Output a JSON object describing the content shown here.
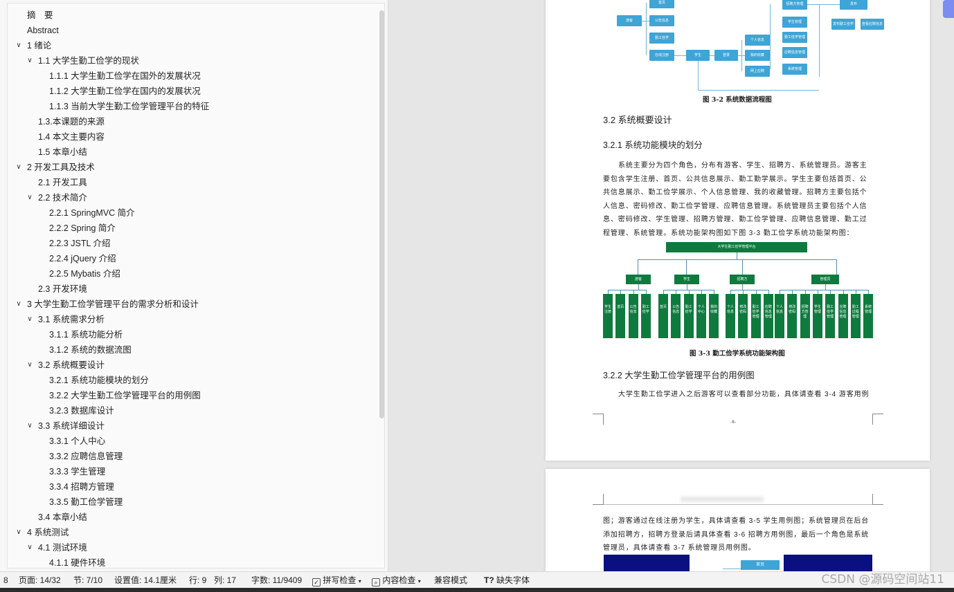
{
  "nav": {
    "items": [
      {
        "label": "摘　要",
        "level": 0,
        "expanded": null
      },
      {
        "label": "Abstract",
        "level": 0,
        "expanded": null
      },
      {
        "label": "1  绪论",
        "level": 0,
        "expanded": true
      },
      {
        "label": "1.1  大学生勤工俭学的现状",
        "level": 1,
        "expanded": true
      },
      {
        "label": "1.1.1  大学生勤工俭学在国外的发展状况",
        "level": 2,
        "expanded": null
      },
      {
        "label": "1.1.2  大学生勤工俭学在国内的发展状况",
        "level": 2,
        "expanded": null
      },
      {
        "label": "1.1.3  当前大学生勤工俭学管理平台的特征",
        "level": 2,
        "expanded": null
      },
      {
        "label": "1.3.本课题的来源",
        "level": 1,
        "expanded": null
      },
      {
        "label": "1.4 本文主要内容",
        "level": 1,
        "expanded": null
      },
      {
        "label": "1.5  本章小结",
        "level": 1,
        "expanded": null
      },
      {
        "label": "2  开发工具及技术",
        "level": 0,
        "expanded": true
      },
      {
        "label": "2.1 开发工具",
        "level": 1,
        "expanded": null
      },
      {
        "label": "2.2 技术简介",
        "level": 1,
        "expanded": true
      },
      {
        "label": "2.2.1 SpringMVC 简介",
        "level": 2,
        "expanded": null
      },
      {
        "label": "2.2.2 Spring 简介",
        "level": 2,
        "expanded": null
      },
      {
        "label": "2.2.3 JSTL 介绍",
        "level": 2,
        "expanded": null
      },
      {
        "label": "2.2.4 jQuery 介绍",
        "level": 2,
        "expanded": null
      },
      {
        "label": "2.2.5 Mybatis 介绍",
        "level": 2,
        "expanded": null
      },
      {
        "label": "2.3 开发环境",
        "level": 1,
        "expanded": null
      },
      {
        "label": "3  大学生勤工俭学管理平台的需求分析和设计",
        "level": 0,
        "expanded": true
      },
      {
        "label": "3.1  系统需求分析",
        "level": 1,
        "expanded": true
      },
      {
        "label": "3.1.1 系统功能分析",
        "level": 2,
        "expanded": null
      },
      {
        "label": "3.1.2 系统的数据流图",
        "level": 2,
        "expanded": null
      },
      {
        "label": "3.2  系统概要设计",
        "level": 1,
        "expanded": true
      },
      {
        "label": "3.2.1  系统功能模块的划分",
        "level": 2,
        "expanded": null
      },
      {
        "label": "3.2.2  大学生勤工俭学管理平台的用例图",
        "level": 2,
        "expanded": null
      },
      {
        "label": "3.2.3 数据库设计",
        "level": 2,
        "expanded": null
      },
      {
        "label": "3.3 系统详细设计",
        "level": 1,
        "expanded": true
      },
      {
        "label": "3.3.1 个人中心",
        "level": 2,
        "expanded": null
      },
      {
        "label": "3.3.2 应聘信息管理",
        "level": 2,
        "expanded": null
      },
      {
        "label": "3.3.3 学生管理",
        "level": 2,
        "expanded": null
      },
      {
        "label": "3.3.4 招聘方管理",
        "level": 2,
        "expanded": null
      },
      {
        "label": "3.3.5 勤工俭学管理",
        "level": 2,
        "expanded": null
      },
      {
        "label": "3.4  本章小结",
        "level": 1,
        "expanded": null
      },
      {
        "label": "4  系统测试",
        "level": 0,
        "expanded": true
      },
      {
        "label": "4.1  测试环境",
        "level": 1,
        "expanded": true
      },
      {
        "label": "4.1.1  硬件环境",
        "level": 2,
        "expanded": null
      }
    ]
  },
  "document": {
    "fig32": {
      "caption": "图 3-2  系统数据流程图",
      "boxes": {
        "visitor": "游客",
        "home": "首页",
        "notice": "公告信息",
        "work_study": "勤工俭学",
        "online_apply": "在线注册",
        "student": "学生",
        "login": "登录",
        "personal_info": "个人信息",
        "my_favorites": "我的收藏",
        "online_apply2": "网上应聘",
        "recruit_mgmt": "招聘方管理",
        "student_mgmt": "学生管理",
        "work_study_mgmt": "勤工俭学管理",
        "apply_info_mgmt": "应聘信息管理",
        "system_mgmt": "系统管理",
        "post": "发布",
        "publish_work": "发布勤工俭学",
        "view_apply": "查看应聘信息"
      }
    },
    "h321_section": "3.2  系统概要设计",
    "h321": "3.2.1  系统功能模块的划分",
    "para1": "系统主要分为四个角色，分布有游客、学生、招聘方、系统管理员。游客主要包含学生注册、首页、公共信息展示、勤工勤学展示。学生主要包括首页、公共信息展示、勤工俭学展示、个人信息管理、我的收藏管理。招聘方主要包括个人信息、密码修改、勤工俭学管理、应聘信息管理。系统管理员主要包括个人信息、密码修改、学生管理、招聘方管理、勤工俭学管理、应聘信息管理、勤工过程管理、系统管理。系统功能架构图如下图 3-3 勤工俭学系统功能架构图：",
    "fig33": {
      "caption": "图 3-3  勤工俭学系统功能架构图",
      "root": "大学生勤工俭学管理平台",
      "roles": [
        "游客",
        "学生",
        "招聘方",
        "管理员"
      ],
      "leaves": [
        [
          "学生注册",
          "首页",
          "公告信息",
          "勤工俭学"
        ],
        [
          "首页",
          "公告信息",
          "勤工俭学",
          "个人中心",
          "我的收藏"
        ],
        [
          "个人信息",
          "修改密码",
          "勤工俭学管理",
          "应聘信息管理"
        ],
        [
          "个人信息",
          "修改密码",
          "招聘方管理",
          "学生管理",
          "勤工俭学管理",
          "应聘信息管理",
          "勤工过程管理",
          "系统管理"
        ]
      ]
    },
    "h322": "3.2.2  大学生勤工俭学管理平台的用例图",
    "para2": "大学生勤工俭学进入之后游客可以查看部分功能，具体请查看 3-4 游客用例",
    "page_number": "-8-",
    "para3": "图；游客通过在线注册为学生，具体请查看 3-5  学生用例图；系统管理员在后台添加招聘方，招聘方登录后请具体查看 3-6 招聘方用例图，最后一个角色是系统管理员，具体请查看 3-7  系统管理员用例图。",
    "fig34_box": "首页"
  },
  "status": {
    "page_prefix": "8",
    "page": "页面: 14/32",
    "section": "节: 7/10",
    "setting": "设置值: 14.1厘米",
    "row": "行: 9",
    "col": "列: 17",
    "words": "字数: 11/9409",
    "spellcheck": "拼写检查",
    "content_check": "内容检查",
    "compat_mode": "兼容模式",
    "missing_font": "缺失字体"
  },
  "watermark": "CSDN @源码空间站11"
}
